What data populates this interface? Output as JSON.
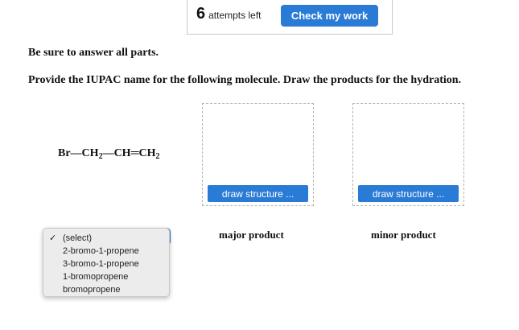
{
  "header": {
    "attempts_count": "6",
    "attempts_label": "attempts left",
    "check_label": "Check my work"
  },
  "instructions": {
    "line1": "Be sure to answer all parts.",
    "line2": "Provide the IUPAC name for the following molecule. Draw the products for the hydration."
  },
  "molecule": {
    "part1": "Br—CH",
    "sub1": "2",
    "part2": "—CH═CH",
    "sub2": "2"
  },
  "draw": {
    "major_button": "draw structure ...",
    "minor_button": "draw structure ...",
    "major_label": "major product",
    "minor_label": "minor product"
  },
  "name_select": {
    "selected": "(select)",
    "options": [
      "(select)",
      "2-bromo-1-propene",
      "3-bromo-1-propene",
      "1-bromopropene",
      "bromopropene"
    ]
  },
  "colors": {
    "accent": "#2a7bd6",
    "dropdown_bg": "#ececec"
  }
}
